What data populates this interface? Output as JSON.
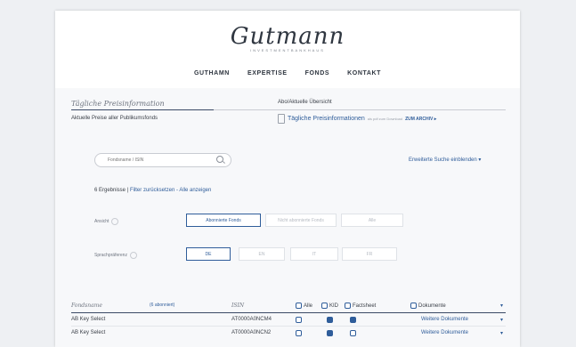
{
  "logo": {
    "script": "Gutmann",
    "sub": "INVESTMENTBANKHAUS"
  },
  "nav": {
    "items": [
      "GUTHAMN",
      "EXPERTISE",
      "FONDS",
      "KONTAKT"
    ]
  },
  "section": {
    "title": "Tägliche Preisinformation",
    "right_title": "Abo/Aktuelle Übersicht"
  },
  "prices": {
    "label": "Aktuelle Preise aller Publikumsfonds"
  },
  "daily": {
    "title": "Tägliche Preisinformationen",
    "sub": "als pdf zum Download",
    "archive": "ZUM ARCHIV ▸"
  },
  "search": {
    "placeholder": "Fondsname / ISIN",
    "extended": "Erweiterte Suche einblenden ▾"
  },
  "results": {
    "count": "6 Ergebnisse",
    "sep": "|",
    "reset": "Filter zurücksetzen",
    "dash": "-",
    "show_all": "Alle anzeigen"
  },
  "view": {
    "label": "Ansicht",
    "options": [
      "Abonnierte Fonds",
      "Nicht abonnierte Fonds",
      "Alle"
    ]
  },
  "language": {
    "label": "Sprachpräferenz",
    "options": [
      "DE",
      "EN",
      "IT",
      "FR"
    ]
  },
  "table": {
    "headers": {
      "fund": "Fondsname",
      "subscribed": "(6 abonniert)",
      "isin": "ISIN",
      "all": "Alle",
      "kid": "KID",
      "factsheet": "Factsheet",
      "documents": "Dokumente"
    },
    "rows": [
      {
        "fund": "AB Key Select",
        "isin": "AT0000A0NCM4",
        "more": "Weitere Dokumente"
      },
      {
        "fund": "AB Key Select",
        "isin": "AT0000A0NCN2",
        "more": "Weitere Dokumente"
      }
    ]
  }
}
